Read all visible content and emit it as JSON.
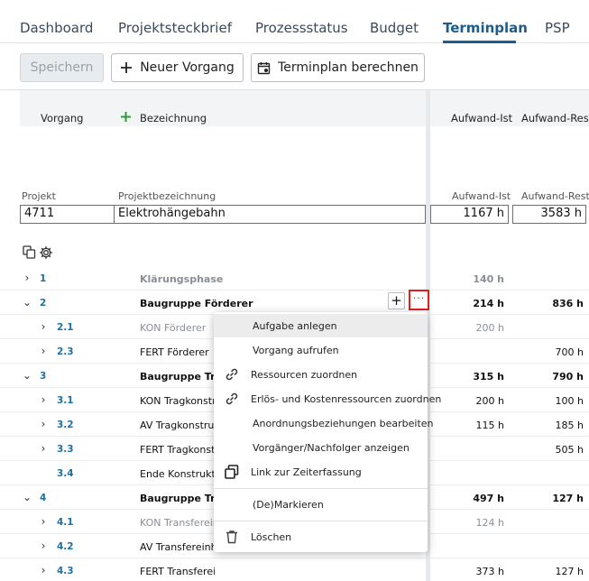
{
  "tabs": [
    {
      "label": "Dashboard"
    },
    {
      "label": "Projektsteckbrief"
    },
    {
      "label": "Prozessstatus"
    },
    {
      "label": "Budget"
    },
    {
      "label": "Terminplan"
    },
    {
      "label": "PSP"
    }
  ],
  "active_tab": "Terminplan",
  "toolbar": {
    "save_label": "Speichern",
    "new_task_label": "Neuer Vorgang",
    "calc_label": "Terminplan berechnen"
  },
  "columns": {
    "vorgang": "Vorgang",
    "bezeichnung": "Bezeichnung",
    "aufwand_ist": "Aufwand-Ist",
    "aufwand_rest": "Aufwand-Rest"
  },
  "project": {
    "project_label": "Projekt",
    "name_label": "Projektbezeichnung",
    "ist_label": "Aufwand-Ist",
    "rest_label": "Aufwand-Rest",
    "id": "4711",
    "name": "Elektrohängebahn",
    "ist": "1167 h",
    "rest": "3583 h"
  },
  "rows": [
    {
      "chevron": "›",
      "num": "1",
      "name": "Klärungsphase",
      "ist": "140 h",
      "rest": "",
      "style": "phase"
    },
    {
      "chevron": "⌄",
      "num": "2",
      "name": "Baugruppe Förderer",
      "ist": "214 h",
      "rest": "836 h",
      "style": "group"
    },
    {
      "chevron": "›",
      "num": "2.1",
      "name": "KON Förderer",
      "ist": "200 h",
      "rest": "",
      "style": "muted"
    },
    {
      "chevron": "›",
      "num": "2.3",
      "name": "FERT Förderer",
      "ist": "",
      "rest": "700 h",
      "style": "normal"
    },
    {
      "chevron": "⌄",
      "num": "3",
      "name": "Baugruppe Tragkonstruktion",
      "ist": "315 h",
      "rest": "790 h",
      "style": "group"
    },
    {
      "chevron": "›",
      "num": "3.1",
      "name": "KON Tragkonstruktion",
      "ist": "200 h",
      "rest": "100 h",
      "style": "normal"
    },
    {
      "chevron": "›",
      "num": "3.2",
      "name": "AV Tragkonstruktion",
      "ist": "115 h",
      "rest": "185 h",
      "style": "normal"
    },
    {
      "chevron": "›",
      "num": "3.3",
      "name": "FERT Tragkonstruktion",
      "ist": "",
      "rest": "505 h",
      "style": "normal"
    },
    {
      "chevron": "",
      "num": "3.4",
      "name": "Ende Konstruktion",
      "ist": "",
      "rest": "",
      "style": "normal"
    },
    {
      "chevron": "⌄",
      "num": "4",
      "name": "Baugruppe Transfereinheit",
      "ist": "497 h",
      "rest": "127 h",
      "style": "group"
    },
    {
      "chevron": "›",
      "num": "4.1",
      "name": "KON Transfereinheit",
      "ist": "124 h",
      "rest": "",
      "style": "muted"
    },
    {
      "chevron": "›",
      "num": "4.2",
      "name": "AV Transfereinheit",
      "ist": "",
      "rest": "",
      "style": "normal"
    },
    {
      "chevron": "›",
      "num": "4.3",
      "name": "FERT Transfereinheit",
      "ist": "373 h",
      "rest": "127 h",
      "style": "normal"
    }
  ],
  "row_actions": {
    "add": "+",
    "more": "···"
  },
  "context_menu": [
    {
      "label": "Aufgabe anlegen",
      "icon": ""
    },
    {
      "label": "Vorgang aufrufen",
      "icon": ""
    },
    {
      "label": "Ressourcen zuordnen",
      "icon": "link-icon"
    },
    {
      "label": "Erlös- und Kostenressourcen zuordnen",
      "icon": "link-icon"
    },
    {
      "label": "Anordnungsbeziehungen bearbeiten",
      "icon": ""
    },
    {
      "label": "Vorgänger/Nachfolger anzeigen",
      "icon": ""
    },
    {
      "label": "Link zur Zeiterfassung",
      "icon": "copy-link-icon"
    },
    {
      "label": "(De)Markieren",
      "icon": ""
    },
    {
      "label": "Löschen",
      "icon": "trash-icon"
    }
  ],
  "colors": {
    "accent": "#1d5c8f",
    "highlight": "#e0201c",
    "add_green": "#2e9b3b"
  }
}
